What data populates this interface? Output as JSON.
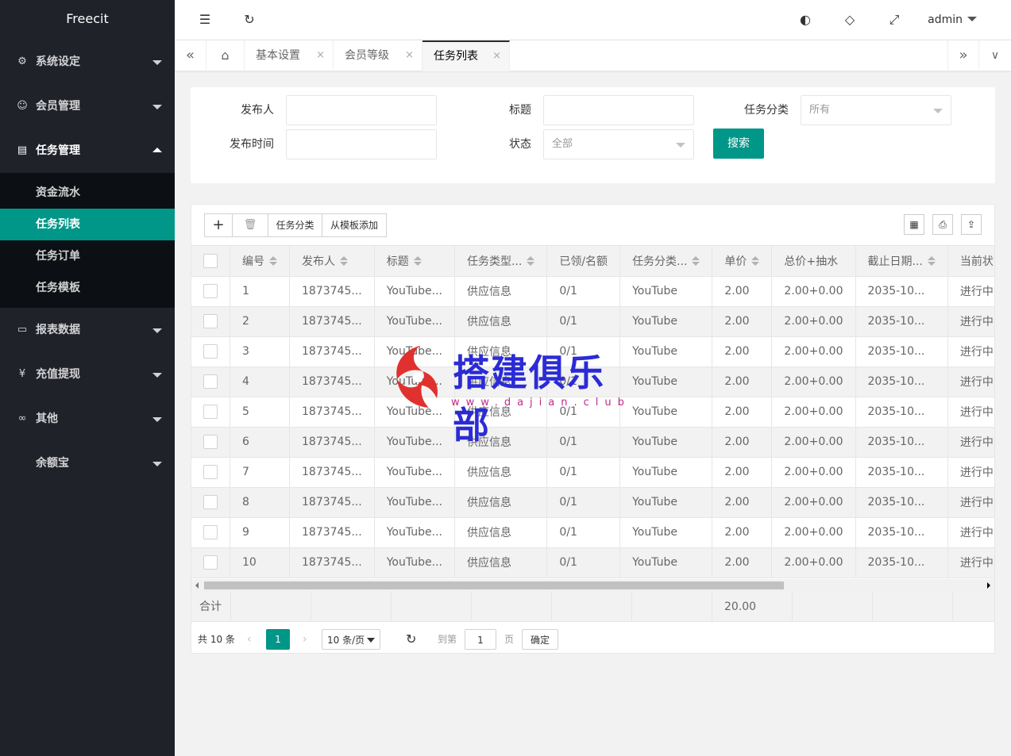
{
  "app": {
    "logo": "Freecit"
  },
  "sidebar": {
    "items": [
      {
        "label": "系统设定",
        "icon": "gear-icon"
      },
      {
        "label": "会员管理",
        "icon": "user-icon"
      },
      {
        "label": "任务管理",
        "icon": "document-icon"
      },
      {
        "label": "报表数据",
        "icon": "monitor-icon"
      },
      {
        "label": "充值提现",
        "icon": "yen-icon"
      },
      {
        "label": "其他",
        "icon": "link-icon"
      },
      {
        "label": "余额宝",
        "icon": ""
      }
    ],
    "subitems": [
      {
        "label": "资金流水"
      },
      {
        "label": "任务列表"
      },
      {
        "label": "任务订单"
      },
      {
        "label": "任务模板"
      }
    ]
  },
  "header": {
    "user": "admin"
  },
  "tabs": [
    {
      "label": "基本设置"
    },
    {
      "label": "会员等级"
    },
    {
      "label": "任务列表"
    }
  ],
  "search": {
    "publisher_label": "发布人",
    "title_label": "标题",
    "category_label": "任务分类",
    "category_value": "所有",
    "time_label": "发布时间",
    "status_label": "状态",
    "status_value": "全部",
    "search_button": "搜索"
  },
  "toolbar": {
    "add": "+",
    "category": "任务分类",
    "from_template": "从模板添加"
  },
  "table": {
    "columns": [
      "编号",
      "发布人",
      "标题",
      "任务类型...",
      "已领/名额",
      "任务分类...",
      "单价",
      "总价+抽水",
      "截止日期...",
      "当前状"
    ],
    "rows": [
      [
        "1",
        "1873745...",
        "YouTube...",
        "供应信息",
        "0/1",
        "YouTube",
        "2.00",
        "2.00+0.00",
        "2035-10...",
        "进行中"
      ],
      [
        "2",
        "1873745...",
        "YouTube...",
        "供应信息",
        "0/1",
        "YouTube",
        "2.00",
        "2.00+0.00",
        "2035-10...",
        "进行中"
      ],
      [
        "3",
        "1873745...",
        "YouTube...",
        "供应信息",
        "0/1",
        "YouTube",
        "2.00",
        "2.00+0.00",
        "2035-10...",
        "进行中"
      ],
      [
        "4",
        "1873745...",
        "YouTube...",
        "供应信息",
        "0/1",
        "YouTube",
        "2.00",
        "2.00+0.00",
        "2035-10...",
        "进行中"
      ],
      [
        "5",
        "1873745...",
        "YouTube...",
        "供应信息",
        "0/1",
        "YouTube",
        "2.00",
        "2.00+0.00",
        "2035-10...",
        "进行中"
      ],
      [
        "6",
        "1873745...",
        "YouTube...",
        "供应信息",
        "0/1",
        "YouTube",
        "2.00",
        "2.00+0.00",
        "2035-10...",
        "进行中"
      ],
      [
        "7",
        "1873745...",
        "YouTube...",
        "供应信息",
        "0/1",
        "YouTube",
        "2.00",
        "2.00+0.00",
        "2035-10...",
        "进行中"
      ],
      [
        "8",
        "1873745...",
        "YouTube...",
        "供应信息",
        "0/1",
        "YouTube",
        "2.00",
        "2.00+0.00",
        "2035-10...",
        "进行中"
      ],
      [
        "9",
        "1873745...",
        "YouTube...",
        "供应信息",
        "0/1",
        "YouTube",
        "2.00",
        "2.00+0.00",
        "2035-10...",
        "进行中"
      ],
      [
        "10",
        "1873745...",
        "YouTube...",
        "供应信息",
        "0/1",
        "YouTube",
        "2.00",
        "2.00+0.00",
        "2035-10...",
        "进行中"
      ]
    ],
    "total_label": "合计",
    "total_value": "20.00"
  },
  "pager": {
    "count": "共 10 条",
    "current": "1",
    "page_size": "10 条/页",
    "goto_label": "到第",
    "goto_value": "1",
    "page_unit": "页",
    "confirm": "确定"
  },
  "watermark": {
    "text": "搭建俱乐部",
    "url": "www.dajian.club"
  },
  "colors": {
    "sidebar": "#20222a",
    "accent": "#009688"
  }
}
